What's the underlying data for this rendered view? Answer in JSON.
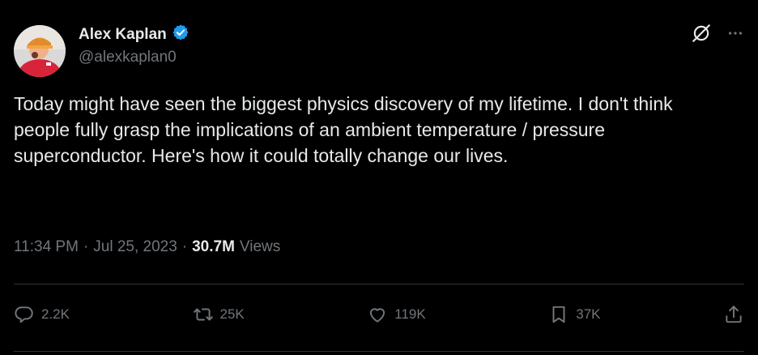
{
  "author": {
    "display_name": "Alex Kaplan",
    "handle": "@alexkaplan0",
    "verified": true,
    "verified_color": "#1d9bf0"
  },
  "tweet": {
    "text": "Today might have seen the biggest physics discovery of my lifetime. I don't think people fully grasp the implications of an ambient temperature / pressure superconductor. Here's how it could totally change our lives.",
    "time": "11:34 PM",
    "sep1": "·",
    "date": "Jul 25, 2023",
    "sep2": "·",
    "views_count": "30.7M",
    "views_label": "Views"
  },
  "actions": {
    "reply": {
      "icon": "reply-icon",
      "count": "2.2K"
    },
    "retweet": {
      "icon": "retweet-icon",
      "count": "25K"
    },
    "like": {
      "icon": "heart-icon",
      "count": "119K"
    },
    "bookmark": {
      "icon": "bookmark-icon",
      "count": "37K"
    },
    "share": {
      "icon": "share-icon"
    }
  },
  "colors": {
    "background": "#000000",
    "text": "#e7e9ea",
    "muted": "#71767b",
    "divider": "#2f3336"
  }
}
